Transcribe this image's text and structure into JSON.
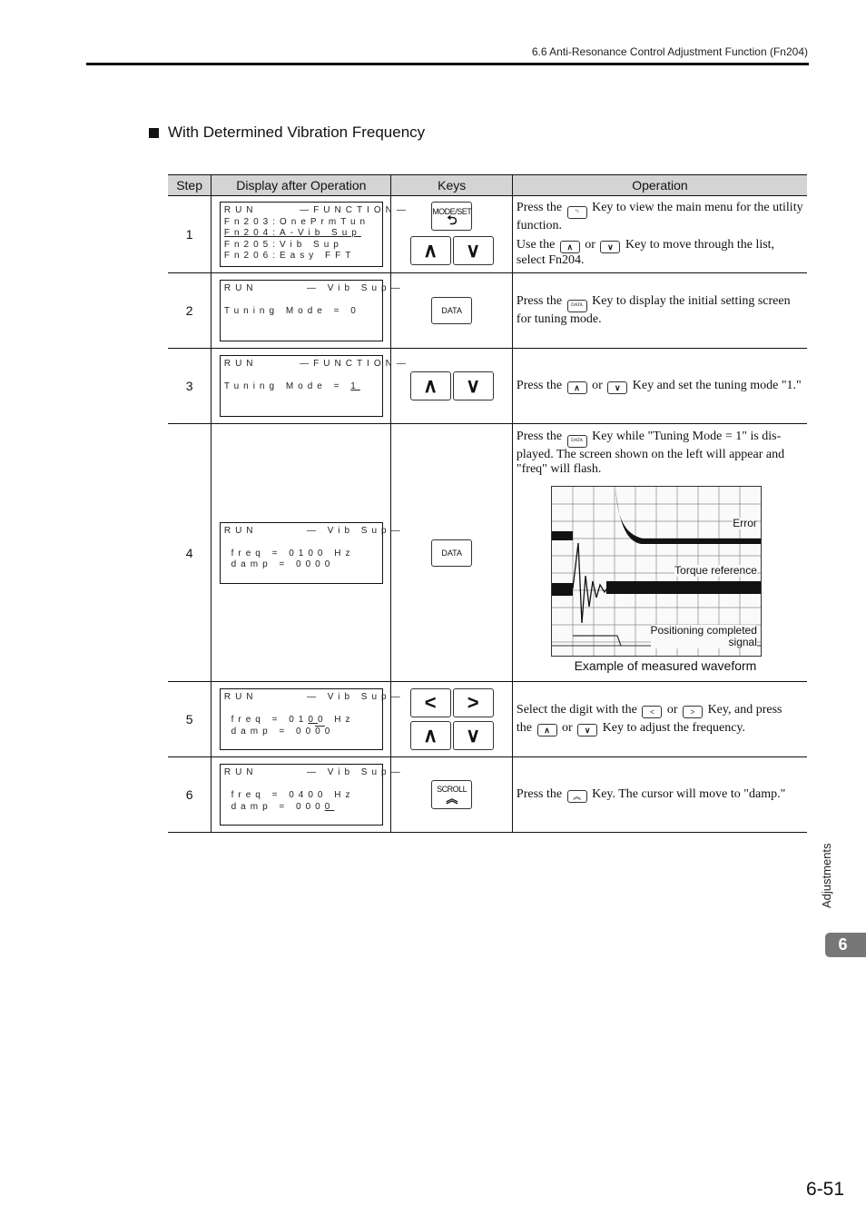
{
  "header": {
    "section_ref": "6.6  Anti-Resonance Control Adjustment Function (Fn204)"
  },
  "section_title": "With Determined Vibration Frequency",
  "table": {
    "columns": [
      "Step",
      "Display after Operation",
      "Keys",
      "Operation"
    ],
    "rows": [
      {
        "step": "1",
        "display": {
          "line1": "RUN      —FUNCTION—",
          "line2": "Fn203:OnePrmTun",
          "line3": "Fn204:A-Vib Sup",
          "line4": "Fn205:Vib Sup",
          "line5": "Fn206:Easy FFT"
        },
        "keys": [
          "MODE/SET",
          "up",
          "down"
        ],
        "operation": {
          "p1_a": "Press the",
          "p1_b": "Key to view the main menu for the utility function.",
          "p2_a": "Use the",
          "p2_or": "or",
          "p2_b": "Key to move through the list, select Fn204."
        }
      },
      {
        "step": "2",
        "display": {
          "line1": "RUN       — Vib Sup—",
          "line2": "Tuning Mode = 0"
        },
        "keys": [
          "DATA"
        ],
        "operation": {
          "p1_a": "Press the",
          "p1_b": "Key to display the initial setting screen for tuning mode."
        }
      },
      {
        "step": "3",
        "display": {
          "line1": "RUN      —FUNCTION—",
          "line2_a": "Tuning Mode = ",
          "line2_cursor": "1"
        },
        "keys": [
          "up",
          "down"
        ],
        "operation": {
          "p1_a": "Press the",
          "p1_or": "or",
          "p1_b": "Key and set the tuning mode \"1.\""
        }
      },
      {
        "step": "4",
        "display": {
          "line1": "RUN       — Vib Sup—",
          "line2": " freq = 0100 Hz",
          "line3": " damp = 0000"
        },
        "keys": [
          "DATA"
        ],
        "operation": {
          "p1_a": "Press the",
          "p1_b": "Key while \"Tuning Mode = 1\" is dis-played. The screen shown on the left will appear and \"freq\" will flash."
        },
        "figure": {
          "labels": {
            "error": "Error",
            "torque": "Torque reference",
            "positioning_1": "Positioning completed",
            "positioning_2": "signal"
          },
          "caption": "Example of measured waveform"
        }
      },
      {
        "step": "5",
        "display": {
          "line1": "RUN       — Vib Sup—",
          "line2_a": " freq = 01",
          "line2_cursor": "0",
          "line2_b": "0 Hz",
          "line3_a": " damp = 00",
          "line3_cursor": "0",
          "line3_b": "0"
        },
        "keys": [
          "left",
          "right",
          "up",
          "down"
        ],
        "operation": {
          "p1_a": "Select the digit with the",
          "p1_or": "or",
          "p1_b": "Key, and press",
          "p2_a": "the",
          "p2_or": "or",
          "p2_b": "Key to adjust the frequency."
        }
      },
      {
        "step": "6",
        "display": {
          "line1": "RUN       — Vib Sup—",
          "line2": " freq = 0400 Hz",
          "line3_a": " damp = 000",
          "line3_cursor": "0"
        },
        "keys": [
          "SCROLL"
        ],
        "operation": {
          "p1_a": "Press the",
          "p1_b": "Key. The cursor will move to \"damp.\""
        }
      }
    ]
  },
  "key_labels": {
    "mode_set": "MODE/SET",
    "data": "DATA",
    "scroll": "SCROLL",
    "up": "∧",
    "down": "∨",
    "left": "<",
    "right": ">"
  },
  "side_tab": {
    "label": "Adjustments",
    "chapter": "6"
  },
  "page_number": "6-51"
}
